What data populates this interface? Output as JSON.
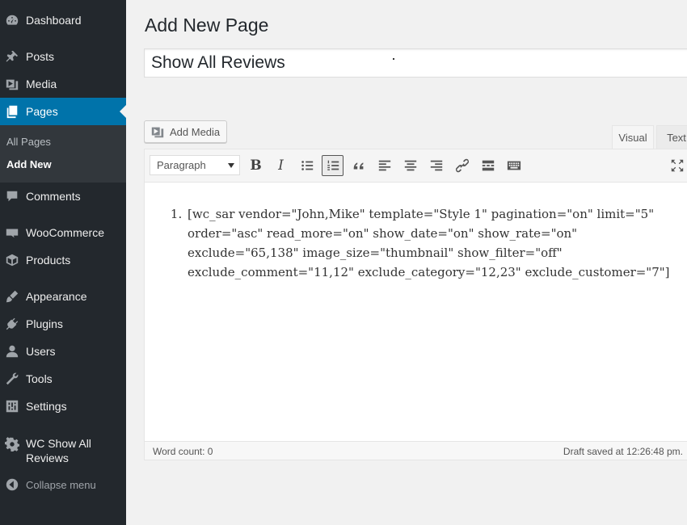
{
  "sidebar": {
    "items": [
      {
        "label": "Dashboard",
        "icon": "dashboard-icon"
      },
      {
        "label": "Posts",
        "icon": "pin-icon"
      },
      {
        "label": "Media",
        "icon": "media-icon"
      },
      {
        "label": "Pages",
        "icon": "pages-icon"
      },
      {
        "label": "Comments",
        "icon": "comments-icon"
      },
      {
        "label": "WooCommerce",
        "icon": "woocommerce-icon"
      },
      {
        "label": "Products",
        "icon": "products-icon"
      },
      {
        "label": "Appearance",
        "icon": "appearance-icon"
      },
      {
        "label": "Plugins",
        "icon": "plugins-icon"
      },
      {
        "label": "Users",
        "icon": "users-icon"
      },
      {
        "label": "Tools",
        "icon": "tools-icon"
      },
      {
        "label": "Settings",
        "icon": "settings-icon"
      },
      {
        "label": "WC Show All Reviews",
        "icon": "gear-icon"
      }
    ],
    "submenu": [
      {
        "label": "All Pages"
      },
      {
        "label": "Add New"
      }
    ],
    "collapse_label": "Collapse menu",
    "active_color": "#0073aa"
  },
  "main": {
    "heading": "Add New Page",
    "title_value": "Show All Reviews",
    "add_media_label": "Add Media",
    "tabs": [
      {
        "label": "Visual"
      },
      {
        "label": "Text"
      }
    ],
    "toolbar": {
      "format_value": "Paragraph",
      "buttons": [
        "bold-icon",
        "italic-icon",
        "bullet-list-icon",
        "numbered-list-icon",
        "blockquote-icon",
        "align-left-icon",
        "align-center-icon",
        "align-right-icon",
        "link-icon",
        "read-more-icon",
        "toolbar-toggle-icon"
      ],
      "bold_glyph": "B",
      "italic_glyph": "I"
    },
    "content_list": [
      "[wc_sar vendor=\"John,Mike\" template=\"Style 1\" pagination=\"on\" limit=\"5\" order=\"asc\" read_more=\"on\" show_date=\"on\" show_rate=\"on\" exclude=\"65,138\" image_size=\"thumbnail\" show_filter=\"off\" exclude_comment=\"11,12\" exclude_category=\"12,23\" exclude_customer=\"7\"]"
    ],
    "word_count": "Word count: 0",
    "draft_saved": "Draft saved at 12:26:48 pm."
  }
}
